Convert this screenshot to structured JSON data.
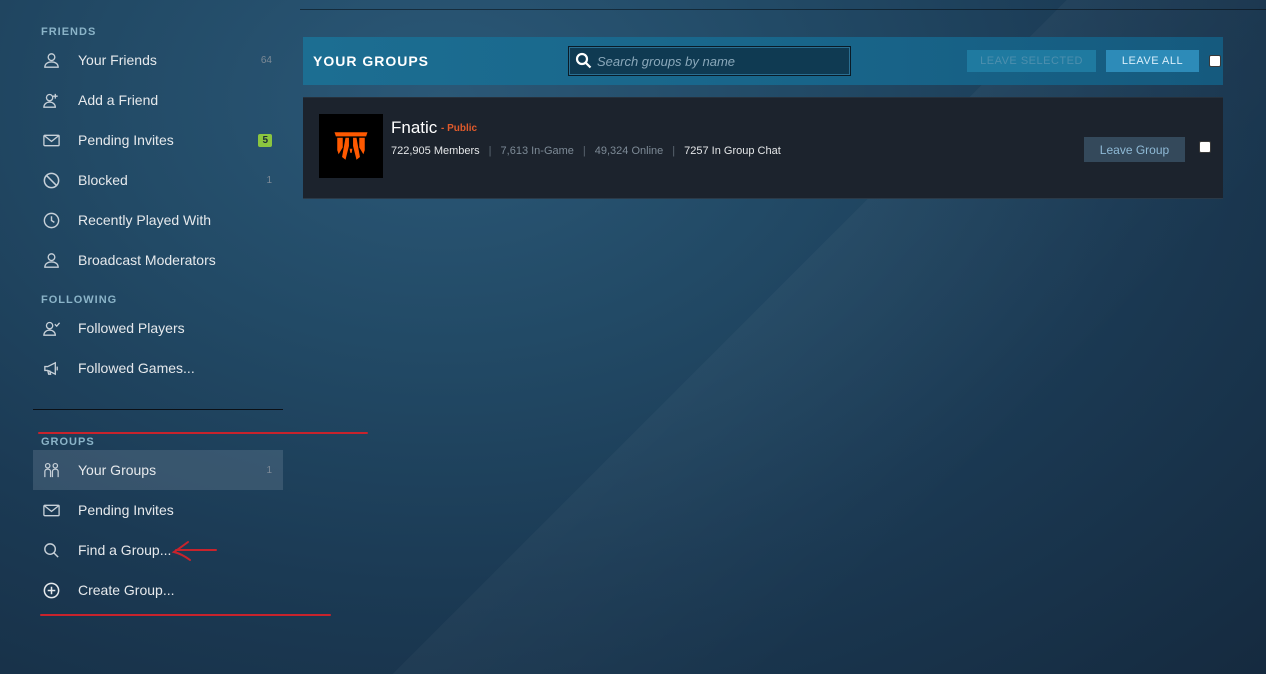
{
  "sidebar": {
    "friends_title": "FRIENDS",
    "following_title": "FOLLOWING",
    "groups_title": "GROUPS",
    "friends_items": [
      {
        "label": "Your Friends",
        "count": "64",
        "icon": "person-icon"
      },
      {
        "label": "Add a Friend",
        "badge": "",
        "icon": "add-person-icon"
      },
      {
        "label": "Pending Invites",
        "badge": "5",
        "icon": "envelope-icon"
      },
      {
        "label": "Blocked",
        "count": "1",
        "icon": "blocked-icon"
      },
      {
        "label": "Recently Played With",
        "icon": "clock-icon"
      },
      {
        "label": "Broadcast Moderators",
        "icon": "person-icon"
      }
    ],
    "following_items": [
      {
        "label": "Followed Players",
        "icon": "followed-players-icon"
      },
      {
        "label": "Followed Games...",
        "icon": "megaphone-icon"
      }
    ],
    "groups_items": [
      {
        "label": "Your Groups",
        "count": "1",
        "icon": "group-icon"
      },
      {
        "label": "Pending Invites",
        "icon": "envelope-icon"
      },
      {
        "label": "Find a Group...",
        "icon": "search-icon"
      },
      {
        "label": "Create Group...",
        "icon": "plus-circle-icon"
      }
    ]
  },
  "main": {
    "header_title": "YOUR GROUPS",
    "search_placeholder": "Search groups by name",
    "leave_selected_label": "LEAVE SELECTED",
    "leave_all_label": "LEAVE ALL",
    "groups": [
      {
        "name": "Fnatic",
        "type": "- Public",
        "members": "722,905 Members",
        "in_game": "7,613 In-Game",
        "online": "49,324 Online",
        "in_chat": "7257 In Group Chat",
        "leave_label": "Leave Group"
      }
    ]
  },
  "colors": {
    "accent_header": "#1c6e92",
    "badge_green": "#8bc53f",
    "public_orange": "#e05a2b",
    "fnatic_logo": "#ff5900",
    "annotation_red": "#c8232c"
  }
}
